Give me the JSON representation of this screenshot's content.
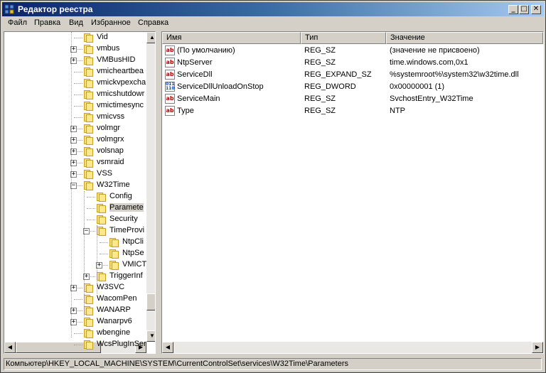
{
  "window": {
    "title": "Редактор реестра",
    "min_label": "_",
    "max_label": "□",
    "close_label": "✕"
  },
  "menu": [
    {
      "label": "Файл"
    },
    {
      "label": "Правка"
    },
    {
      "label": "Вид"
    },
    {
      "label": "Избранное"
    },
    {
      "label": "Справка"
    }
  ],
  "tree": {
    "items": [
      {
        "label": "Vid",
        "expander": ""
      },
      {
        "label": "vmbus",
        "expander": "+"
      },
      {
        "label": "VMBusHID",
        "expander": "+"
      },
      {
        "label": "vmicheartbea",
        "expander": ""
      },
      {
        "label": "vmickvpexcha",
        "expander": ""
      },
      {
        "label": "vmicshutdowr",
        "expander": ""
      },
      {
        "label": "vmictimesync",
        "expander": ""
      },
      {
        "label": "vmicvss",
        "expander": ""
      },
      {
        "label": "volmgr",
        "expander": "+"
      },
      {
        "label": "volmgrx",
        "expander": "+"
      },
      {
        "label": "volsnap",
        "expander": "+"
      },
      {
        "label": "vsmraid",
        "expander": "+"
      },
      {
        "label": "VSS",
        "expander": "+"
      },
      {
        "label": "W32Time",
        "expander": "−"
      },
      {
        "label": "Config",
        "expander": ""
      },
      {
        "label": "Paramete",
        "expander": "",
        "selected": true
      },
      {
        "label": "Security",
        "expander": ""
      },
      {
        "label": "TimeProvi",
        "expander": "−"
      },
      {
        "label": "NtpCli",
        "expander": ""
      },
      {
        "label": "NtpSe",
        "expander": ""
      },
      {
        "label": "VMICT",
        "expander": "+"
      },
      {
        "label": "TriggerInf",
        "expander": "+"
      },
      {
        "label": "W3SVC",
        "expander": "+"
      },
      {
        "label": "WacomPen",
        "expander": ""
      },
      {
        "label": "WANARP",
        "expander": "+"
      },
      {
        "label": "Wanarpv6",
        "expander": "+"
      },
      {
        "label": "wbengine",
        "expander": ""
      },
      {
        "label": "WcsPlugInSer",
        "expander": ""
      }
    ]
  },
  "list": {
    "columns": [
      "Имя",
      "Тип",
      "Значение"
    ],
    "rows": [
      {
        "name": "(По умолчанию)",
        "type": "REG_SZ",
        "value": "(значение не присвоено)",
        "icon": "string-value-icon",
        "icon_text": "ab"
      },
      {
        "name": "NtpServer",
        "type": "REG_SZ",
        "value": "time.windows.com,0x1",
        "icon": "string-value-icon",
        "icon_text": "ab"
      },
      {
        "name": "ServiceDll",
        "type": "REG_EXPAND_SZ",
        "value": "%systemroot%\\system32\\w32time.dll",
        "icon": "string-value-icon",
        "icon_text": "ab"
      },
      {
        "name": "ServiceDllUnloadOnStop",
        "type": "REG_DWORD",
        "value": "0x00000001 (1)",
        "icon": "binary-value-icon",
        "icon_text": "011 110"
      },
      {
        "name": "ServiceMain",
        "type": "REG_SZ",
        "value": "SvchostEntry_W32Time",
        "icon": "string-value-icon",
        "icon_text": "ab"
      },
      {
        "name": "Type",
        "type": "REG_SZ",
        "value": "NTP",
        "icon": "string-value-icon",
        "icon_text": "ab"
      }
    ]
  },
  "status": {
    "path": "Компьютер\\HKEY_LOCAL_MACHINE\\SYSTEM\\CurrentControlSet\\services\\W32Time\\Parameters"
  },
  "scroll": {
    "up": "▲",
    "down": "▼",
    "left": "◀",
    "right": "▶"
  },
  "colors": {
    "title_bar": "#0a246a",
    "string_icon": "#c00000",
    "binary_icon": "#0040c0"
  }
}
